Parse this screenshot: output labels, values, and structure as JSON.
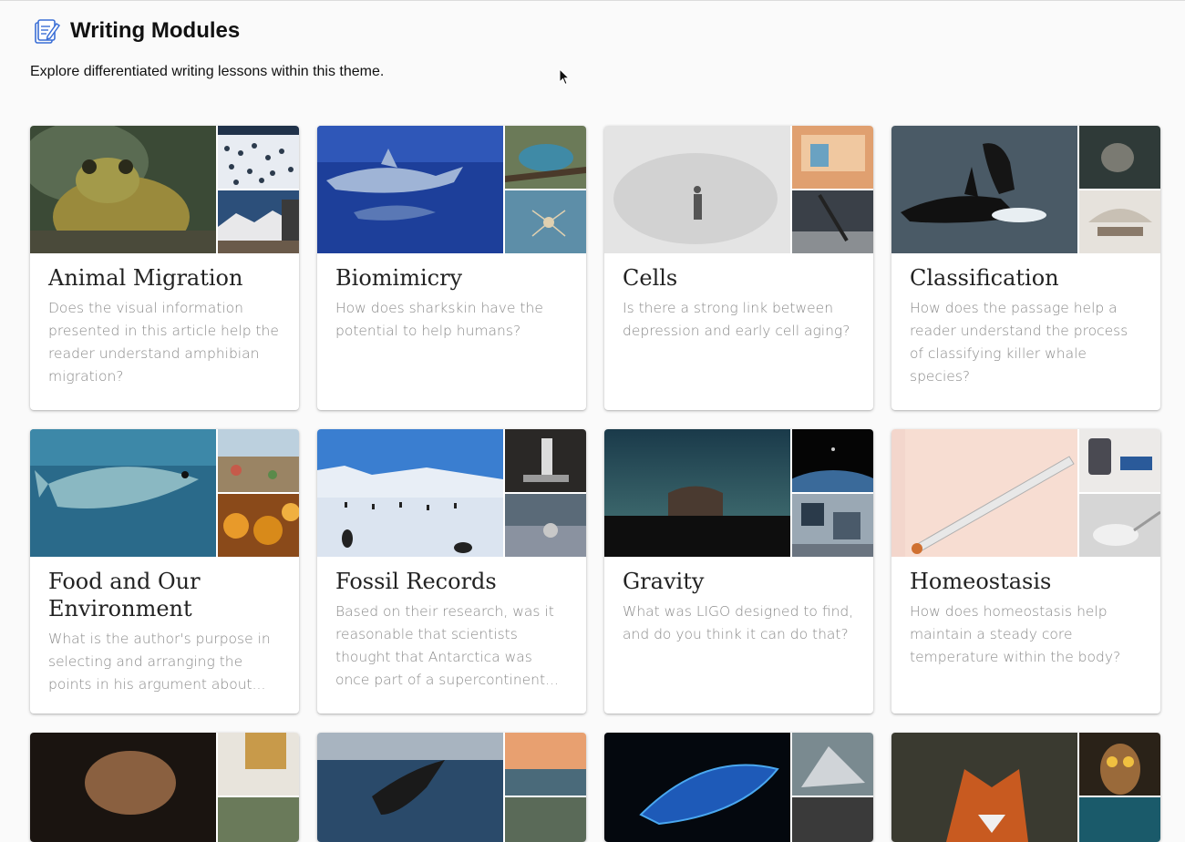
{
  "header": {
    "title": "Writing Modules",
    "subtitle": "Explore differentiated writing lessons within this theme."
  },
  "cards": [
    {
      "title": "Animal Migration",
      "description": "Does the visual information presented in this article help the reader understand amphibian migration?"
    },
    {
      "title": "Biomimicry",
      "description": "How does sharkskin have the potential to help humans?"
    },
    {
      "title": "Cells",
      "description": "Is there a strong link between depression and early cell aging?"
    },
    {
      "title": "Classification",
      "description": "How does the passage help a reader understand the process of classifying killer whale species?"
    },
    {
      "title": "Food and Our Environment",
      "description": "What is the author's purpose in selecting and arranging the points in his argument about..."
    },
    {
      "title": "Fossil Records",
      "description": "Based on their research, was it reasonable that scientists thought that Antarctica was once part of a supercontinent..."
    },
    {
      "title": "Gravity",
      "description": "What was LIGO designed to find, and do you think it can do that?"
    },
    {
      "title": "Homeostasis",
      "description": "How does homeostasis help maintain a steady core temperature within the body?"
    }
  ],
  "icons": {
    "header": "writing-notebook-icon",
    "cursor": "mouse-pointer-icon"
  }
}
